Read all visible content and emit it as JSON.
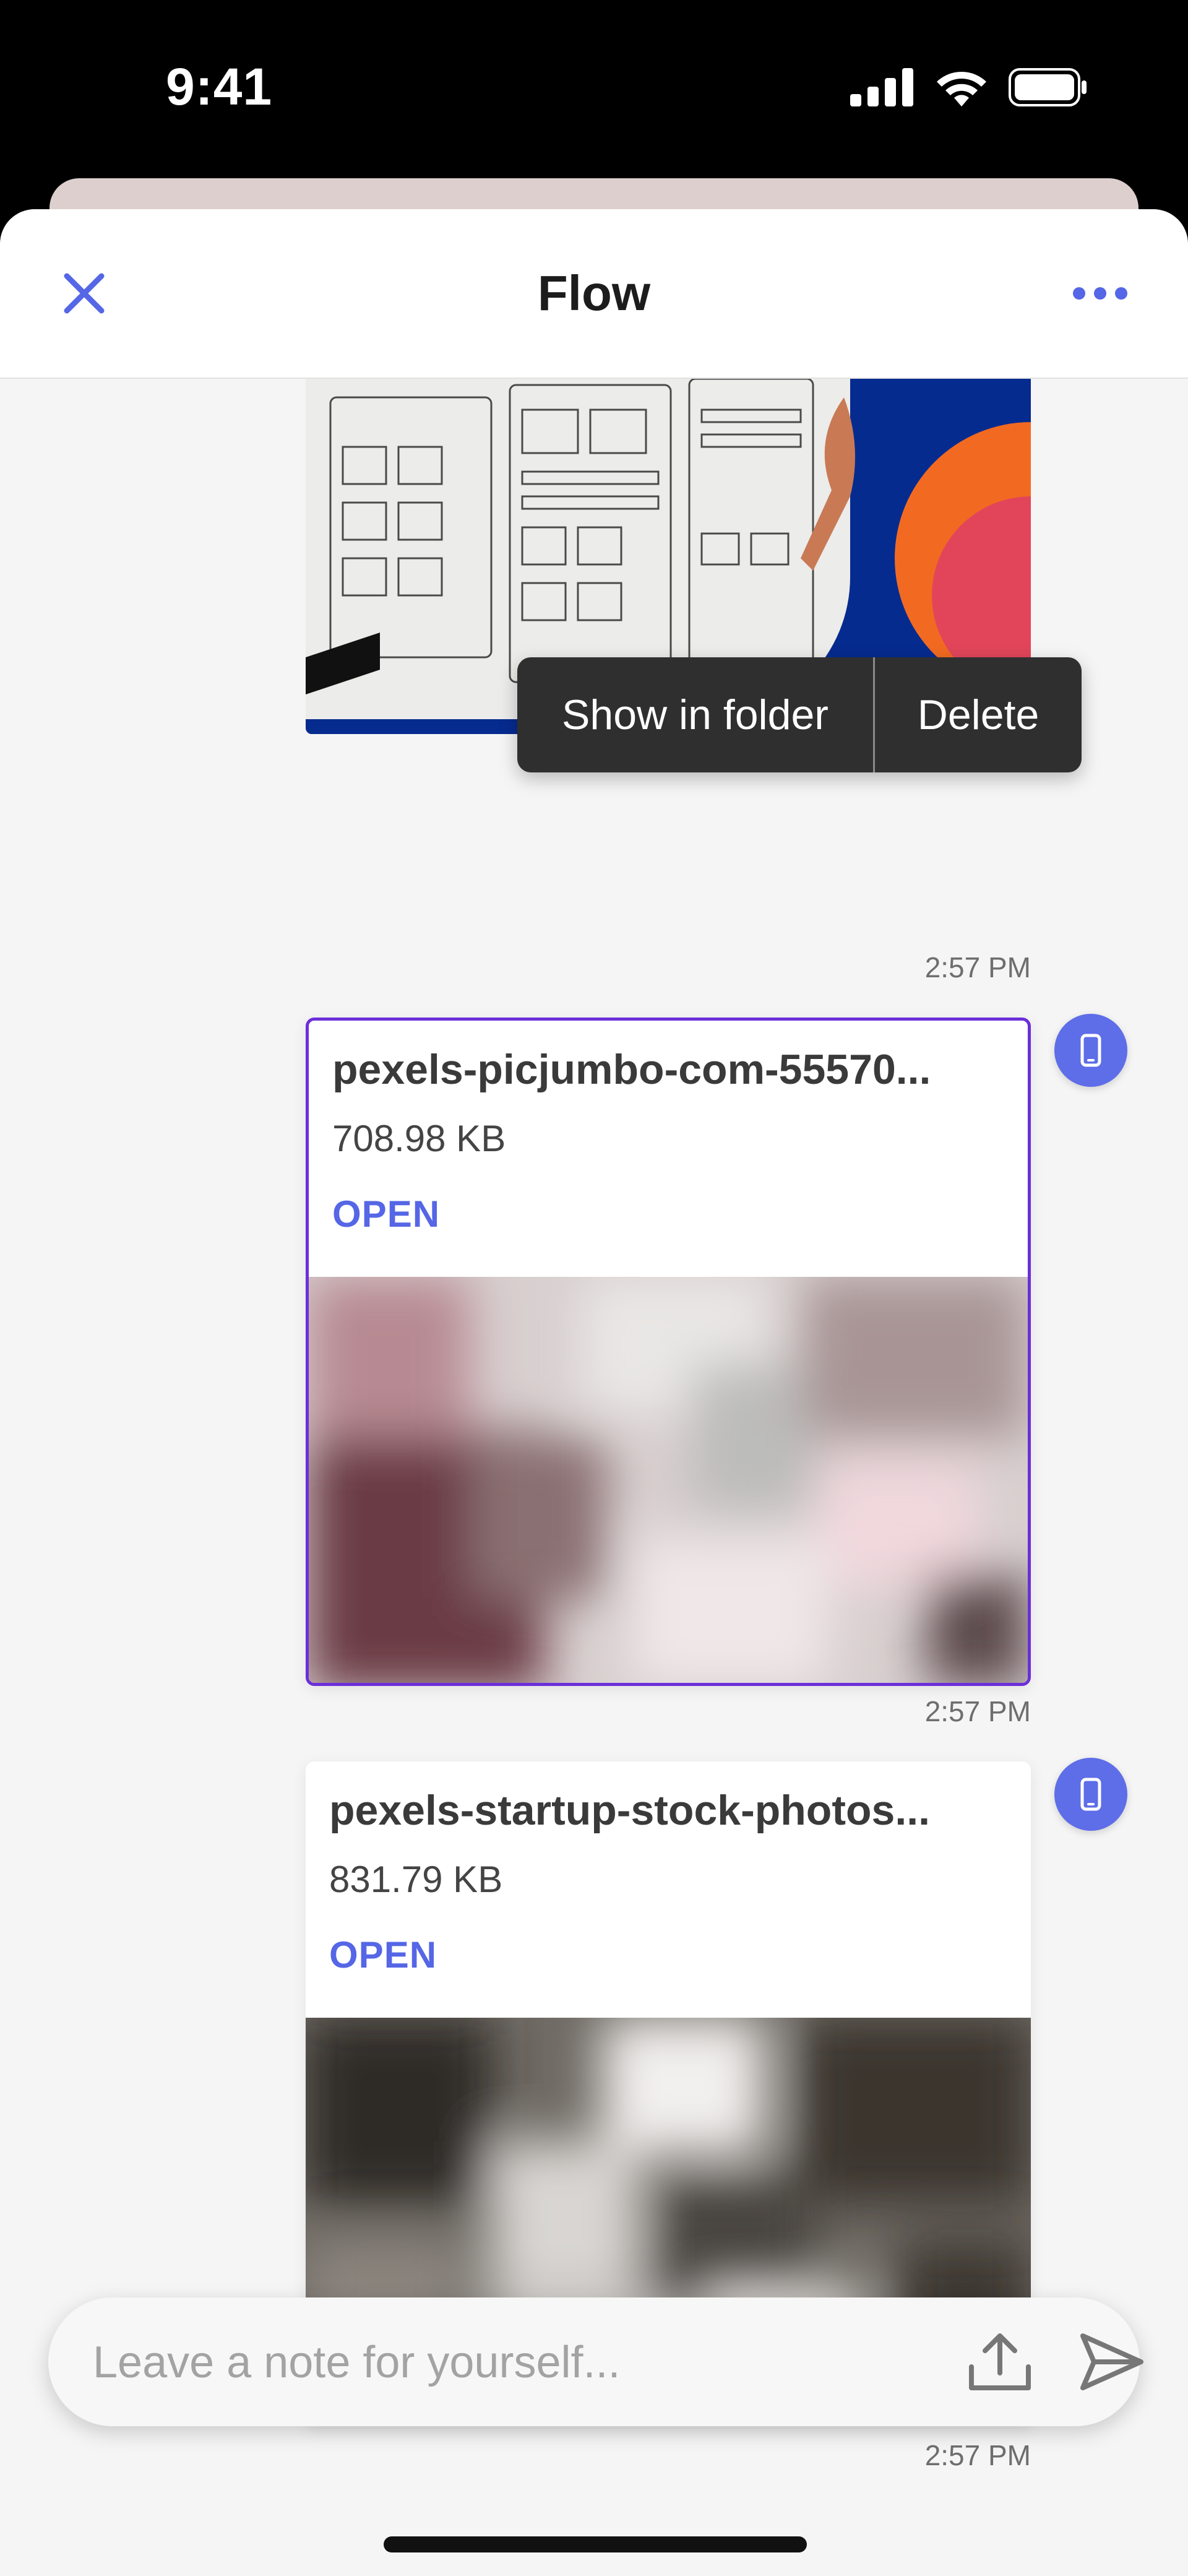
{
  "status_bar": {
    "time": "9:41"
  },
  "header": {
    "title": "Flow"
  },
  "messages": [
    {
      "type": "image",
      "timestamp": "2:57 PM"
    },
    {
      "type": "file",
      "name": "pexels-picjumbo-com-55570...",
      "size": "708.98 KB",
      "open_label": "OPEN",
      "timestamp": "2:57 PM",
      "selected": true
    },
    {
      "type": "file",
      "name": "pexels-startup-stock-photos...",
      "size": "831.79 KB",
      "open_label": "OPEN",
      "timestamp": "2:57 PM",
      "selected": false
    }
  ],
  "context_menu": {
    "items": [
      "Show in folder",
      "Delete"
    ]
  },
  "composer": {
    "placeholder": "Leave a note for yourself..."
  },
  "colors": {
    "accent": "#5e6de8",
    "selected_border": "#6b2fd9",
    "menu_bg": "#2f2f2f"
  },
  "icons": [
    "close-icon",
    "more-icon",
    "phone-icon",
    "upload-icon",
    "send-icon",
    "signal-icon",
    "wifi-icon",
    "battery-icon"
  ]
}
